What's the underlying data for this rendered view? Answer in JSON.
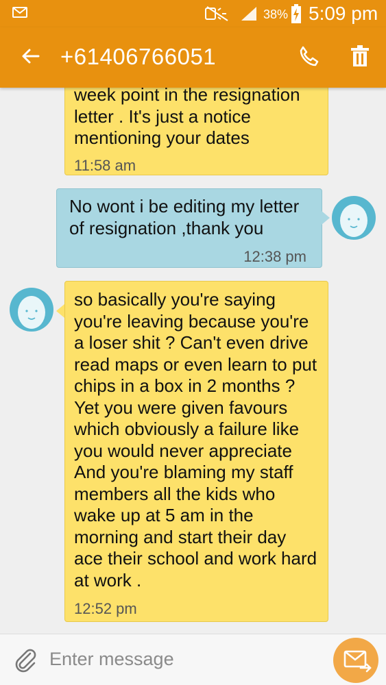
{
  "status_bar": {
    "battery_percent": "38%",
    "time": "5:09 pm",
    "icons": [
      "mail-notification-icon",
      "mute-icon",
      "signal-icon",
      "battery-charging-icon"
    ]
  },
  "app_bar": {
    "title": "+61406766051",
    "back_icon": "arrow-left-icon",
    "call_icon": "phone-icon",
    "delete_icon": "trash-icon",
    "accent": "#e8910f"
  },
  "messages": [
    {
      "direction": "incoming",
      "text": "week point  in the resignation\nletter . It's just a notice\nmentioning your dates",
      "time": "11:58 am",
      "color": "#fde16a"
    },
    {
      "direction": "outgoing",
      "text": "No wont i be editing my letter\nof resignation ,thank you",
      "time": "12:38 pm",
      "color": "#a9d7e2"
    },
    {
      "direction": "incoming",
      "text": "so basically you're saying\nyou're leaving because you're\na loser  shit ? Can't even drive\nread maps or even learn to put\nchips in a box in 2 months ?\nYet you were given favours\nwhich obviously a failure like\nyou would never appreciate\nAnd you're blaming my staff\nmembers all the kids who\nwake up at 5 am in the\nmorning and start their day\nace their school and work hard\nat work .",
      "time": "12:52 pm",
      "color": "#fde16a"
    }
  ],
  "composer": {
    "placeholder": "Enter message",
    "attach_icon": "paperclip-icon",
    "send_icon": "send-icon"
  }
}
